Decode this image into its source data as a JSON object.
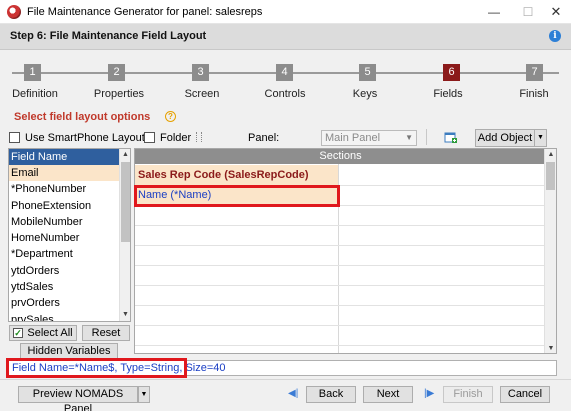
{
  "window": {
    "title": "File Maintenance Generator for panel: salesreps",
    "minimize": "—",
    "maximize": "☐",
    "close": "✕"
  },
  "header": {
    "title": "Step 6: File Maintenance Field Layout",
    "info_icon": "i"
  },
  "steps": [
    {
      "num": "1",
      "label": "Definition"
    },
    {
      "num": "2",
      "label": "Properties"
    },
    {
      "num": "3",
      "label": "Screen"
    },
    {
      "num": "4",
      "label": "Controls"
    },
    {
      "num": "5",
      "label": "Keys"
    },
    {
      "num": "6",
      "label": "Fields"
    },
    {
      "num": "7",
      "label": "Finish"
    }
  ],
  "active_step": 6,
  "options": {
    "section_label": "Select field layout options",
    "help_icon": "?",
    "smartphone_label": "Use SmartPhone Layout",
    "folder_label": "Folder",
    "panel_label": "Panel:",
    "panel_value": "Main Panel",
    "add_object_label": "Add Object"
  },
  "field_list": {
    "header": "Field Name",
    "items": [
      "Email",
      "*PhoneNumber",
      "PhoneExtension",
      "MobileNumber",
      "HomeNumber",
      "*Department",
      "ytdOrders",
      "ytdSales",
      "prvOrders",
      "prvSales"
    ],
    "selected_index": 0,
    "select_all_label": "Select All",
    "reset_label": "Reset",
    "hidden_vars_label": "Hidden Variables"
  },
  "sections": {
    "header": "Sections",
    "title_cell": "Sales Rep Code (SalesRepCode)",
    "name_cell": "Name (*Name)"
  },
  "status_text": "Field Name=*Name$, Type=String, Size=40",
  "bottom": {
    "preview_label": "Preview NOMADS Panel",
    "back_label": "Back",
    "next_label": "Next",
    "finish_label": "Finish",
    "cancel_label": "Cancel"
  },
  "colors": {
    "active_step": "#8b1a1a",
    "highlight": "#e0181d",
    "selection": "#fbe5c9",
    "list_header": "#2f5f9e"
  }
}
